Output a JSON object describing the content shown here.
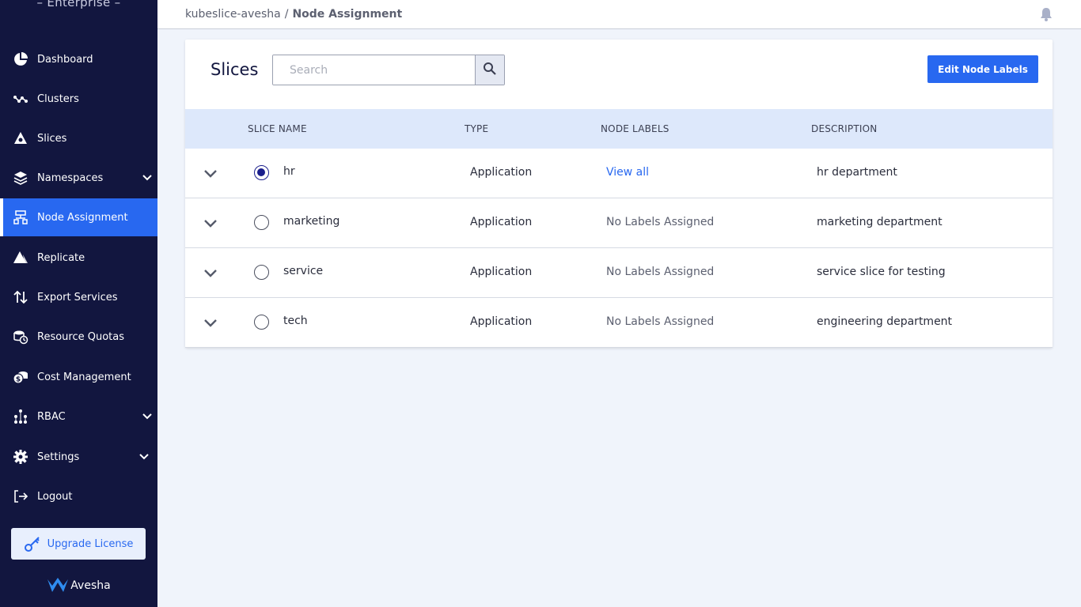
{
  "sidebar": {
    "brand_top": "– Enterprise –",
    "items": [
      {
        "label": "Dashboard",
        "icon": "pie-chart-icon"
      },
      {
        "label": "Clusters",
        "icon": "graph-nodes-icon"
      },
      {
        "label": "Slices",
        "icon": "slice-pyramid-icon"
      },
      {
        "label": "Namespaces",
        "icon": "layers-icon",
        "expandable": true
      },
      {
        "label": "Node Assignment",
        "icon": "node-tree-icon",
        "active": true
      },
      {
        "label": "Replicate",
        "icon": "replicate-icon"
      },
      {
        "label": "Export Services",
        "icon": "arrows-up-down-icon"
      },
      {
        "label": "Resource Quotas",
        "icon": "quota-clock-icon"
      },
      {
        "label": "Cost Management",
        "icon": "coins-icon"
      },
      {
        "label": "RBAC",
        "icon": "people-network-icon",
        "expandable": true
      },
      {
        "label": "Settings",
        "icon": "gear-icon",
        "expandable": true
      },
      {
        "label": "Logout",
        "icon": "logout-icon"
      }
    ],
    "upgrade_label": "Upgrade License",
    "brand_bottom": "Avesha"
  },
  "header": {
    "breadcrumb_root": "kubeslice-avesha",
    "breadcrumb_sep": "/",
    "breadcrumb_current": "Node Assignment"
  },
  "card": {
    "title": "Slices",
    "search_placeholder": "Search",
    "edit_button": "Edit Node Labels",
    "columns": {
      "name": "SLICE NAME",
      "type": "TYPE",
      "labels": "NODE LABELS",
      "description": "DESCRIPTION"
    },
    "rows": [
      {
        "name": "hr",
        "type": "Application",
        "labels": "View all",
        "description": "hr department",
        "selected": true
      },
      {
        "name": "marketing",
        "type": "Application",
        "labels": "No Labels Assigned",
        "description": "marketing department",
        "selected": false
      },
      {
        "name": "service",
        "type": "Application",
        "labels": "No Labels Assigned",
        "description": "service slice for testing",
        "selected": false
      },
      {
        "name": "tech",
        "type": "Application",
        "labels": "No Labels Assigned",
        "description": "engineering department",
        "selected": false
      }
    ]
  },
  "colors": {
    "sidebar_bg": "#12163f",
    "accent": "#2868f0",
    "table_header_bg": "#dde8fb",
    "page_bg": "#f0f4fb"
  }
}
